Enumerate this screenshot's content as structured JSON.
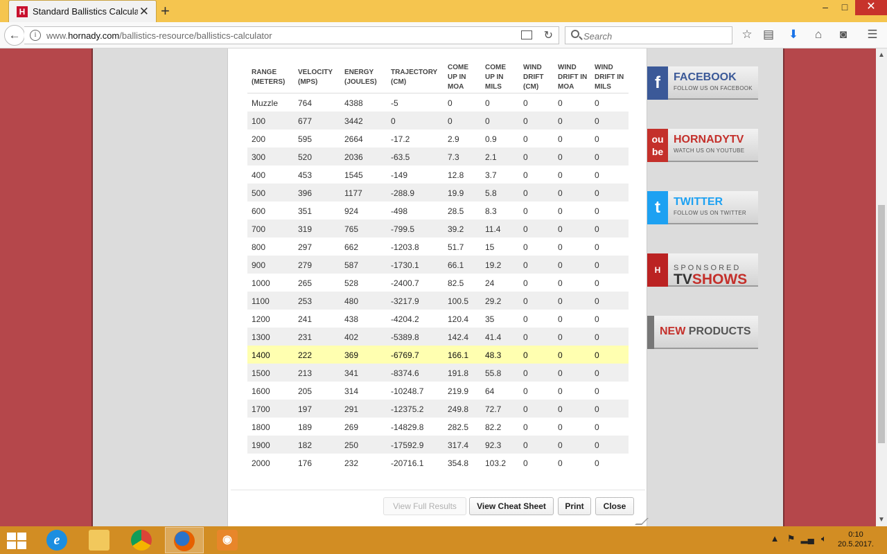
{
  "browser": {
    "tab_title": "Standard Ballistics Calculato",
    "tab_close": "✕",
    "new_tab": "+",
    "favicon": "H",
    "url_prefix": "www.",
    "url_domain": "hornady.com",
    "url_path": "/ballistics-resource/ballistics-calculator",
    "search_placeholder": "Search",
    "window_controls": {
      "minimize": "–",
      "maximize": "□",
      "close": "✕"
    },
    "back": "←",
    "reload": "↻",
    "tools": {
      "bookmark": "☆",
      "library": "▤",
      "download": "⬇",
      "home": "⌂",
      "pocket": "◙",
      "menu": "☰"
    }
  },
  "table": {
    "headers": [
      [
        "RANGE",
        "(METERS)"
      ],
      [
        "VELOCITY",
        "(MPS)"
      ],
      [
        "ENERGY",
        "(JOULES)"
      ],
      [
        "TRAJECTORY",
        "(CM)"
      ],
      [
        "COME",
        "UP IN",
        "MOA"
      ],
      [
        "COME",
        "UP IN",
        "MILS"
      ],
      [
        "WIND",
        "DRIFT",
        "(CM)"
      ],
      [
        "WIND",
        "DRIFT IN",
        "MOA"
      ],
      [
        "WIND",
        "DRIFT IN",
        "MILS"
      ]
    ],
    "rows": [
      [
        "Muzzle",
        "764",
        "4388",
        "-5",
        "0",
        "0",
        "0",
        "0",
        "0"
      ],
      [
        "100",
        "677",
        "3442",
        "0",
        "0",
        "0",
        "0",
        "0",
        "0"
      ],
      [
        "200",
        "595",
        "2664",
        "-17.2",
        "2.9",
        "0.9",
        "0",
        "0",
        "0"
      ],
      [
        "300",
        "520",
        "2036",
        "-63.5",
        "7.3",
        "2.1",
        "0",
        "0",
        "0"
      ],
      [
        "400",
        "453",
        "1545",
        "-149",
        "12.8",
        "3.7",
        "0",
        "0",
        "0"
      ],
      [
        "500",
        "396",
        "1177",
        "-288.9",
        "19.9",
        "5.8",
        "0",
        "0",
        "0"
      ],
      [
        "600",
        "351",
        "924",
        "-498",
        "28.5",
        "8.3",
        "0",
        "0",
        "0"
      ],
      [
        "700",
        "319",
        "765",
        "-799.5",
        "39.2",
        "11.4",
        "0",
        "0",
        "0"
      ],
      [
        "800",
        "297",
        "662",
        "-1203.8",
        "51.7",
        "15",
        "0",
        "0",
        "0"
      ],
      [
        "900",
        "279",
        "587",
        "-1730.1",
        "66.1",
        "19.2",
        "0",
        "0",
        "0"
      ],
      [
        "1000",
        "265",
        "528",
        "-2400.7",
        "82.5",
        "24",
        "0",
        "0",
        "0"
      ],
      [
        "1100",
        "253",
        "480",
        "-3217.9",
        "100.5",
        "29.2",
        "0",
        "0",
        "0"
      ],
      [
        "1200",
        "241",
        "438",
        "-4204.2",
        "120.4",
        "35",
        "0",
        "0",
        "0"
      ],
      [
        "1300",
        "231",
        "402",
        "-5389.8",
        "142.4",
        "41.4",
        "0",
        "0",
        "0"
      ],
      [
        "1400",
        "222",
        "369",
        "-6769.7",
        "166.1",
        "48.3",
        "0",
        "0",
        "0"
      ],
      [
        "1500",
        "213",
        "341",
        "-8374.6",
        "191.8",
        "55.8",
        "0",
        "0",
        "0"
      ],
      [
        "1600",
        "205",
        "314",
        "-10248.7",
        "219.9",
        "64",
        "0",
        "0",
        "0"
      ],
      [
        "1700",
        "197",
        "291",
        "-12375.2",
        "249.8",
        "72.7",
        "0",
        "0",
        "0"
      ],
      [
        "1800",
        "189",
        "269",
        "-14829.8",
        "282.5",
        "82.2",
        "0",
        "0",
        "0"
      ],
      [
        "1900",
        "182",
        "250",
        "-17592.9",
        "317.4",
        "92.3",
        "0",
        "0",
        "0"
      ],
      [
        "2000",
        "176",
        "232",
        "-20716.1",
        "354.8",
        "103.2",
        "0",
        "0",
        "0"
      ]
    ],
    "highlight_row": "1400"
  },
  "buttons": {
    "full_results": "View Full Results",
    "cheat_sheet": "View Cheat Sheet",
    "print": "Print",
    "close": "Close"
  },
  "sidebar": {
    "facebook": {
      "title": "FACEBOOK",
      "sub": "FOLLOW US ON FACEBOOK",
      "logo": "f"
    },
    "youtube": {
      "title": "HORNADYTV",
      "sub": "WATCH US ON YOUTUBE",
      "logo": "ou\nbe"
    },
    "twitter": {
      "title": "TWITTER",
      "sub": "FOLLOW US ON TWITTER",
      "logo": "t"
    },
    "tvshows": {
      "sponsored": "SPONSORED",
      "tv": "TV",
      "shows": "SHOWS",
      "logo": "H"
    },
    "newproducts": {
      "new": "NEW",
      "products": " PRODUCTS"
    }
  },
  "taskbar": {
    "clock_time": "0:10",
    "clock_date": "20.5.2017."
  },
  "colors": {
    "brand_red": "#c8102e",
    "page_bg": "#b5474b",
    "taskbar": "#d28d23",
    "titlebar": "#f5c54f",
    "highlight": "#ffffb0"
  }
}
